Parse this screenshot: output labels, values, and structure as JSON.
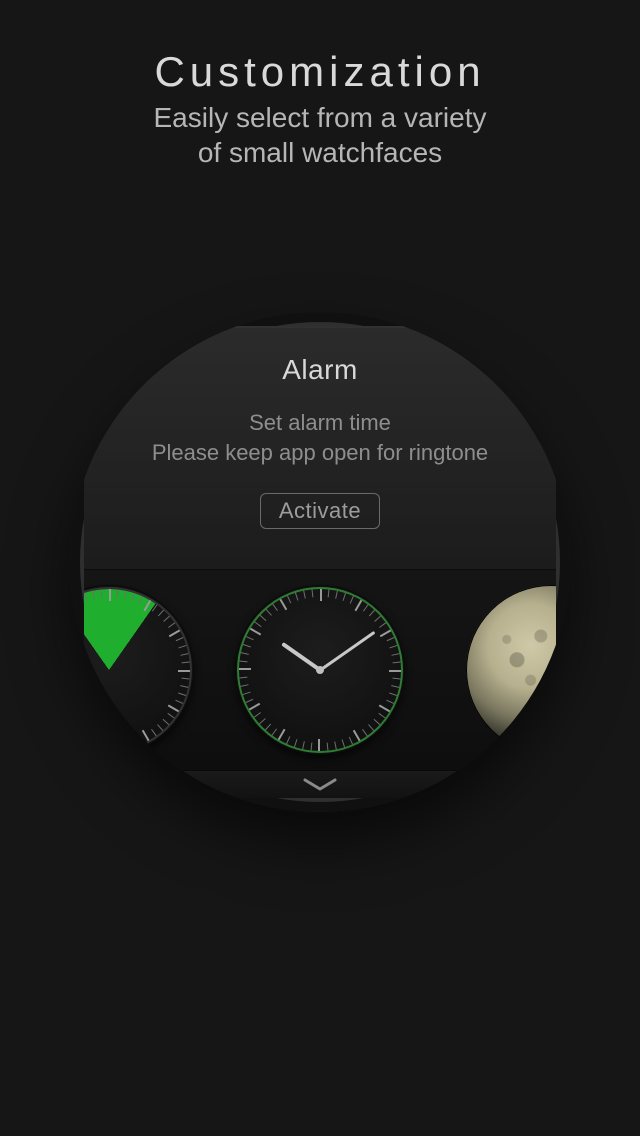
{
  "hero": {
    "title": "Customization",
    "subtitle_line1": "Easily select from a variety",
    "subtitle_line2": "of small watchfaces"
  },
  "panel": {
    "title": "Alarm",
    "message_line1": "Set alarm time",
    "message_line2": "Please keep app open for ringtone",
    "activate_label": "Activate"
  },
  "carousel": {
    "faces": [
      {
        "id": "wedge-analog",
        "accent": "#1fae2e"
      },
      {
        "id": "green-ring-analog",
        "accent": "#2e7d32"
      },
      {
        "id": "moon-phase",
        "accent": "#cfc9a8"
      }
    ]
  },
  "icons": {
    "chevron": "chevron-down-icon"
  },
  "colors": {
    "background": "#161616",
    "text_primary": "#d9d9d9",
    "text_secondary": "#8e8e8e",
    "accent_green": "#1fae2e"
  }
}
